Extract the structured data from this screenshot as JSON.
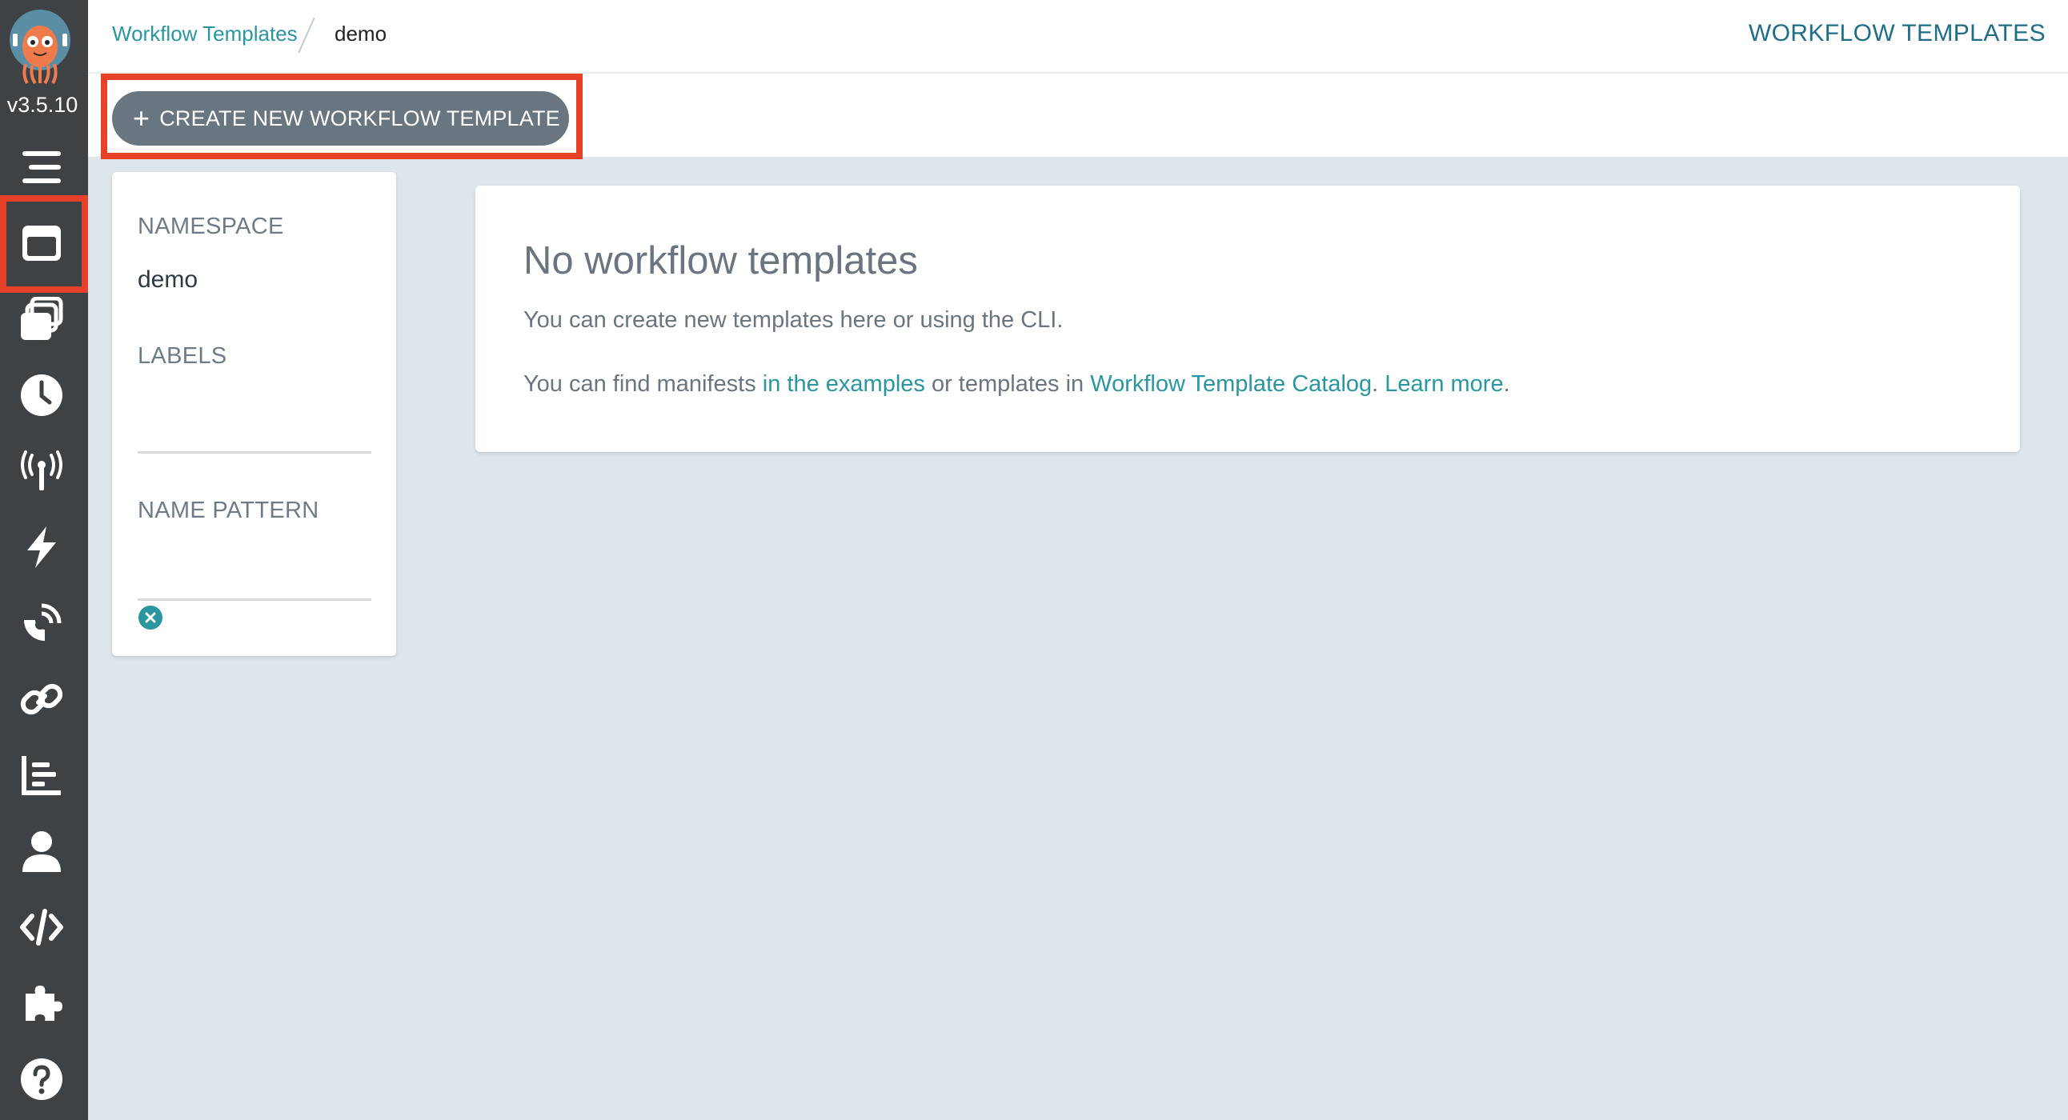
{
  "app": {
    "version": "v3.5.10"
  },
  "sidebar": {
    "items": [
      {
        "icon": "hamburger-icon"
      },
      {
        "icon": "workflow-templates-icon",
        "active": true
      },
      {
        "icon": "cluster-templates-icon"
      },
      {
        "icon": "clock-icon"
      },
      {
        "icon": "event-source-icon"
      },
      {
        "icon": "lightning-icon"
      },
      {
        "icon": "satellite-icon"
      },
      {
        "icon": "link-icon"
      },
      {
        "icon": "reports-icon"
      },
      {
        "icon": "user-icon"
      },
      {
        "icon": "code-icon"
      },
      {
        "icon": "plugin-icon"
      },
      {
        "icon": "help-icon"
      }
    ]
  },
  "header": {
    "breadcrumb": {
      "link": "Workflow Templates",
      "current": "demo"
    },
    "title": "WORKFLOW TEMPLATES"
  },
  "toolbar": {
    "create_label": "CREATE NEW WORKFLOW TEMPLATE"
  },
  "filters": {
    "namespace_label": "NAMESPACE",
    "namespace_value": "demo",
    "labels_label": "LABELS",
    "name_pattern_label": "NAME PATTERN"
  },
  "empty_state": {
    "title": "No workflow templates",
    "line1": "You can create new templates here or using the CLI.",
    "line2_prefix": "You can find manifests ",
    "link_examples": "in the examples",
    "line2_mid": " or templates in ",
    "link_catalog": "Workflow Template Catalog",
    "line2_sep": ". ",
    "link_learn": "Learn more",
    "line2_end": "."
  },
  "colors": {
    "sidebar_bg": "#3e4245",
    "accent": "#2a96a0",
    "button_bg": "#69757f",
    "highlight": "#e8412a",
    "page_bg": "#dee6eb"
  }
}
